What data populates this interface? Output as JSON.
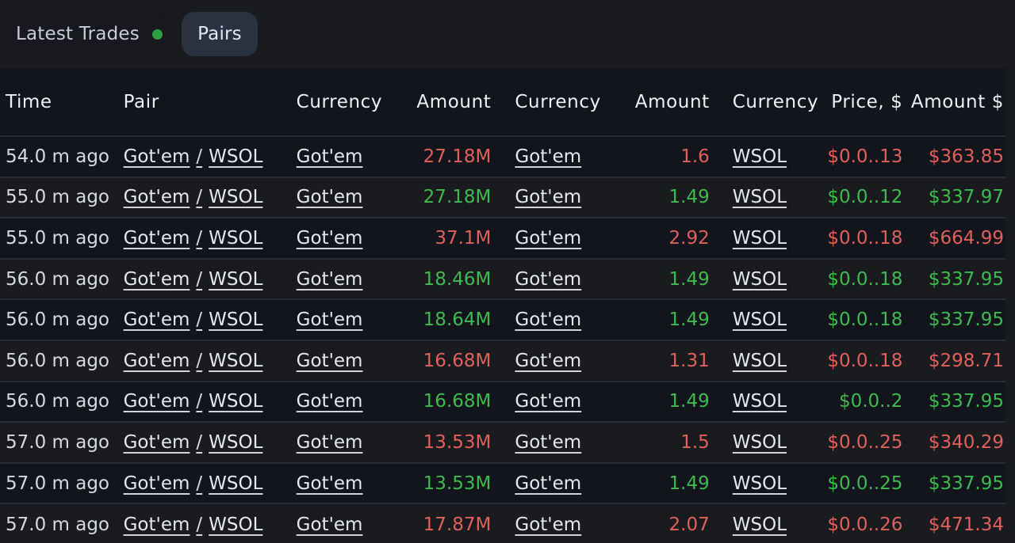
{
  "tabs": [
    {
      "label": "Latest Trades",
      "live": true
    },
    {
      "label": "Pairs"
    }
  ],
  "colors": {
    "buy": "#3fb950",
    "sell": "#e0605c",
    "live_dot": "#2ea043"
  },
  "table": {
    "headers": {
      "time": "Time",
      "pair": "Pair",
      "currency1": "Currency",
      "amount1": "Amount",
      "currency2": "Currency",
      "amount2": "Amount",
      "currency3": "Currency",
      "price": "Price, $",
      "amount_usd": "Amount $"
    },
    "rows": [
      {
        "time": "54.0 m ago",
        "base": "Got'em",
        "quote": "WSOL",
        "currency1": "Got'em",
        "amount1": "27.18M",
        "currency2": "Got'em",
        "amount2": "1.6",
        "currency3": "WSOL",
        "price": "$0.0..13",
        "amount_usd": "$363.85",
        "side": "sell"
      },
      {
        "time": "55.0 m ago",
        "base": "Got'em",
        "quote": "WSOL",
        "currency1": "Got'em",
        "amount1": "27.18M",
        "currency2": "Got'em",
        "amount2": "1.49",
        "currency3": "WSOL",
        "price": "$0.0..12",
        "amount_usd": "$337.97",
        "side": "buy"
      },
      {
        "time": "55.0 m ago",
        "base": "Got'em",
        "quote": "WSOL",
        "currency1": "Got'em",
        "amount1": "37.1M",
        "currency2": "Got'em",
        "amount2": "2.92",
        "currency3": "WSOL",
        "price": "$0.0..18",
        "amount_usd": "$664.99",
        "side": "sell"
      },
      {
        "time": "56.0 m ago",
        "base": "Got'em",
        "quote": "WSOL",
        "currency1": "Got'em",
        "amount1": "18.46M",
        "currency2": "Got'em",
        "amount2": "1.49",
        "currency3": "WSOL",
        "price": "$0.0..18",
        "amount_usd": "$337.95",
        "side": "buy"
      },
      {
        "time": "56.0 m ago",
        "base": "Got'em",
        "quote": "WSOL",
        "currency1": "Got'em",
        "amount1": "18.64M",
        "currency2": "Got'em",
        "amount2": "1.49",
        "currency3": "WSOL",
        "price": "$0.0..18",
        "amount_usd": "$337.95",
        "side": "buy"
      },
      {
        "time": "56.0 m ago",
        "base": "Got'em",
        "quote": "WSOL",
        "currency1": "Got'em",
        "amount1": "16.68M",
        "currency2": "Got'em",
        "amount2": "1.31",
        "currency3": "WSOL",
        "price": "$0.0..18",
        "amount_usd": "$298.71",
        "side": "sell"
      },
      {
        "time": "56.0 m ago",
        "base": "Got'em",
        "quote": "WSOL",
        "currency1": "Got'em",
        "amount1": "16.68M",
        "currency2": "Got'em",
        "amount2": "1.49",
        "currency3": "WSOL",
        "price": "$0.0..2",
        "amount_usd": "$337.95",
        "side": "buy"
      },
      {
        "time": "57.0 m ago",
        "base": "Got'em",
        "quote": "WSOL",
        "currency1": "Got'em",
        "amount1": "13.53M",
        "currency2": "Got'em",
        "amount2": "1.5",
        "currency3": "WSOL",
        "price": "$0.0..25",
        "amount_usd": "$340.29",
        "side": "sell"
      },
      {
        "time": "57.0 m ago",
        "base": "Got'em",
        "quote": "WSOL",
        "currency1": "Got'em",
        "amount1": "13.53M",
        "currency2": "Got'em",
        "amount2": "1.49",
        "currency3": "WSOL",
        "price": "$0.0..25",
        "amount_usd": "$337.95",
        "side": "buy"
      },
      {
        "time": "57.0 m ago",
        "base": "Got'em",
        "quote": "WSOL",
        "currency1": "Got'em",
        "amount1": "17.87M",
        "currency2": "Got'em",
        "amount2": "2.07",
        "currency3": "WSOL",
        "price": "$0.0..26",
        "amount_usd": "$471.34",
        "side": "sell"
      }
    ]
  }
}
